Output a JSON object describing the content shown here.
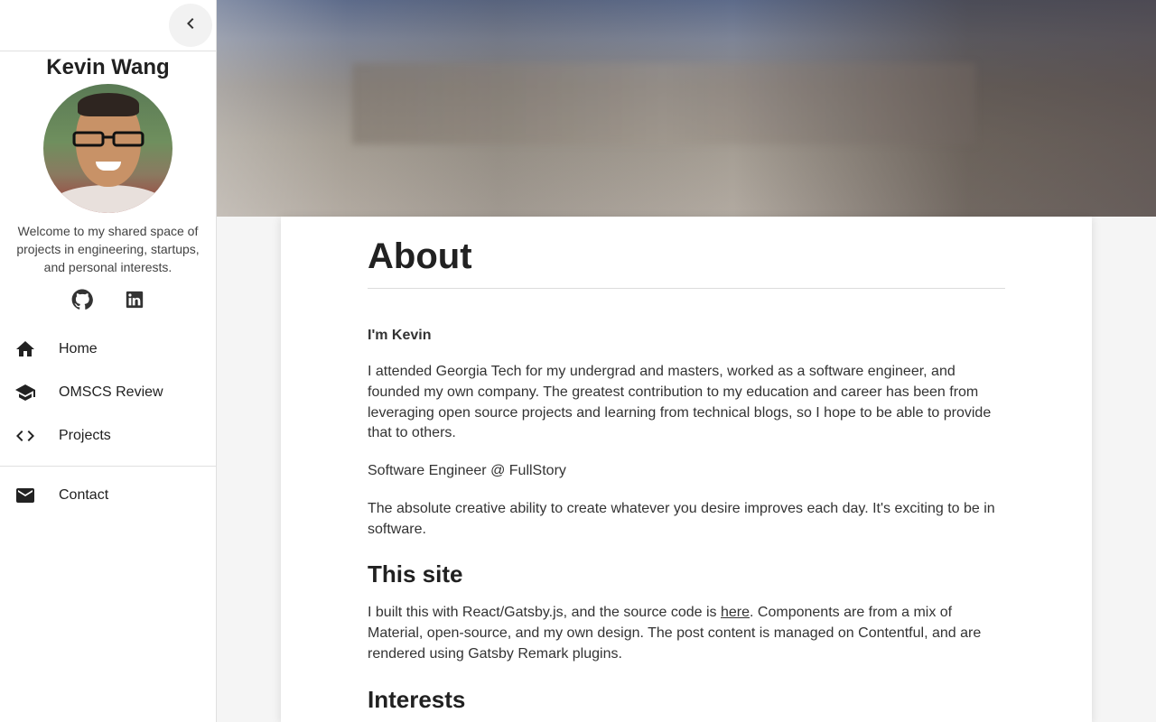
{
  "sidebar": {
    "name": "Kevin Wang",
    "welcome": "Welcome to my shared space of projects in engineering, startups, and personal interests.",
    "social": [
      "github-icon",
      "linkedin-icon"
    ],
    "nav": [
      {
        "label": "Home",
        "icon": "home-icon"
      },
      {
        "label": "OMSCS Review",
        "icon": "school-icon"
      },
      {
        "label": "Projects",
        "icon": "code-icon"
      }
    ],
    "contact": {
      "label": "Contact",
      "icon": "mail-icon"
    }
  },
  "main": {
    "title": "About",
    "intro_heading": "I'm Kevin",
    "intro_paragraph": "I attended Georgia Tech for my undergrad and masters, worked as a software engineer, and founded my own company. The greatest contribution to my education and career has been from leveraging open source projects and learning from technical blogs, so I hope to be able to provide that to others.",
    "role": "Software Engineer @ FullStory",
    "creative": "The absolute creative ability to create whatever you desire improves each day. It's exciting to be in software.",
    "site_heading": "This site",
    "site_text_before": "I built this with React/Gatsby.js, and the source code is ",
    "site_link": "here",
    "site_text_after": ". Components are from a mix of Material, open-source, and my own design. The post content is managed on Contentful, and are rendered using Gatsby Remark plugins.",
    "interests_heading": "Interests"
  }
}
